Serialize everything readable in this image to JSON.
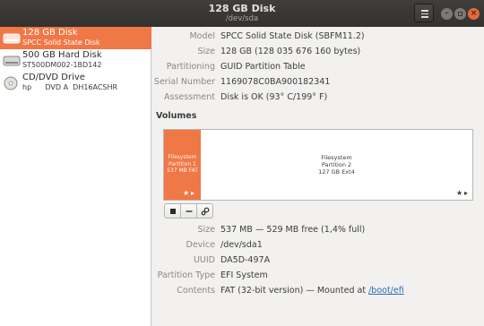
{
  "window": {
    "title": "128 GB Disk",
    "subtitle": "/dev/sda"
  },
  "sidebar": {
    "items": [
      {
        "name": "128 GB Disk",
        "sub": "SPCC Solid State Disk",
        "icon": "harddisk-icon",
        "selected": true
      },
      {
        "name": "500 GB Hard Disk",
        "sub": "ST500DM002-1BD142",
        "icon": "harddisk-icon",
        "selected": false
      },
      {
        "name": "CD/DVD Drive",
        "sub": "hp      DVD A  DH16ACSHR",
        "icon": "optical-disc-icon",
        "selected": false
      }
    ]
  },
  "disk_info": {
    "model_label": "Model",
    "model": "SPCC Solid State Disk (SBFM11.2)",
    "size_label": "Size",
    "size": "128 GB (128 035 676 160 bytes)",
    "partitioning_label": "Partitioning",
    "partitioning": "GUID Partition Table",
    "serial_label": "Serial Number",
    "serial": "1169078C0BA900182341",
    "assessment_label": "Assessment",
    "assessment": "Disk is OK (93° C/199° F)"
  },
  "volumes": {
    "title": "Volumes",
    "partitions": [
      {
        "line1": "Filesystem",
        "line2": "Partition 1",
        "line3": "537 MB FAT",
        "selected": true
      },
      {
        "line1": "Filesystem",
        "line2": "Partition 2",
        "line3": "127 GB Ext4",
        "selected": false
      }
    ]
  },
  "partition_info": {
    "size_label": "Size",
    "size": "537 MB — 529 MB free (1,4% full)",
    "device_label": "Device",
    "device": "/dev/sda1",
    "uuid_label": "UUID",
    "uuid": "DA5D-497A",
    "type_label": "Partition Type",
    "type": "EFI System",
    "contents_label": "Contents",
    "contents_prefix": "FAT (32-bit version) — Mounted at ",
    "contents_link": "/boot/efi"
  },
  "colors": {
    "accent": "#f07746",
    "titlebar": "#3a3936",
    "link": "#2a6cb3"
  }
}
